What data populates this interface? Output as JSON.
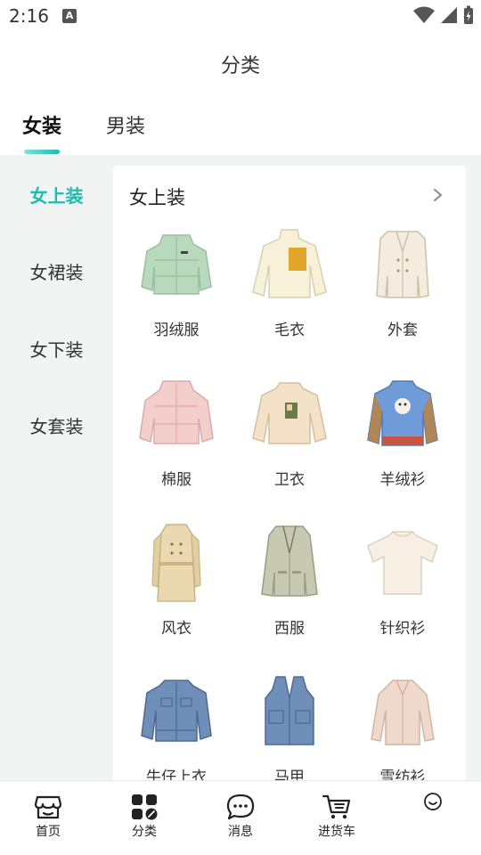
{
  "status": {
    "time": "2:16",
    "notif_glyph": "A",
    "icons": [
      "wifi-icon",
      "signal-icon",
      "battery-charging-icon"
    ]
  },
  "header": {
    "title": "分类"
  },
  "top_tabs": [
    {
      "label": "女装",
      "active": true
    },
    {
      "label": "男装",
      "active": false
    }
  ],
  "side_nav": [
    {
      "label": "女上装",
      "active": true
    },
    {
      "label": "女裙装",
      "active": false
    },
    {
      "label": "女下装",
      "active": false
    },
    {
      "label": "女套装",
      "active": false
    }
  ],
  "panel": {
    "title": "女上装",
    "items": [
      {
        "label": "羽绒服",
        "icon": "down-jacket-image"
      },
      {
        "label": "毛衣",
        "icon": "sweater-image"
      },
      {
        "label": "外套",
        "icon": "coat-image"
      },
      {
        "label": "棉服",
        "icon": "padded-jacket-image"
      },
      {
        "label": "卫衣",
        "icon": "sweatshirt-image"
      },
      {
        "label": "羊绒衫",
        "icon": "cashmere-sweater-image"
      },
      {
        "label": "风衣",
        "icon": "trench-coat-image"
      },
      {
        "label": "西服",
        "icon": "blazer-image"
      },
      {
        "label": "针织衫",
        "icon": "knit-top-image"
      },
      {
        "label": "牛仔上衣",
        "icon": "denim-jacket-image"
      },
      {
        "label": "马甲",
        "icon": "vest-image"
      },
      {
        "label": "雪纺衫",
        "icon": "chiffon-blouse-image"
      }
    ]
  },
  "bottom_nav": [
    {
      "label": "首页",
      "icon": "shop-icon"
    },
    {
      "label": "分类",
      "icon": "category-grid-icon"
    },
    {
      "label": "消息",
      "icon": "message-bubble-icon"
    },
    {
      "label": "进货车",
      "icon": "cart-icon"
    },
    {
      "label": "",
      "icon": "smile-icon"
    }
  ],
  "colors": {
    "accent": "#1fbcb0",
    "background": "#f2f4f4",
    "text": "#333333"
  }
}
